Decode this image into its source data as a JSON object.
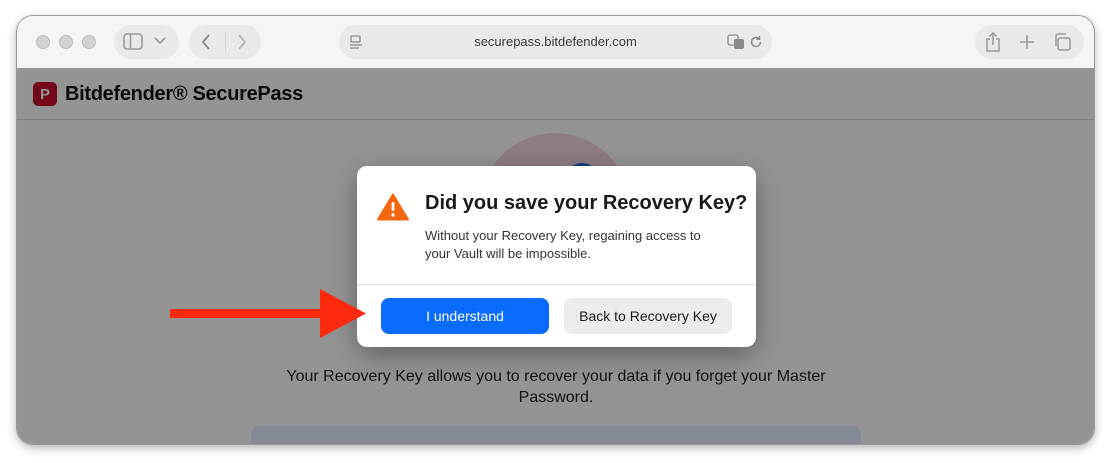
{
  "browser": {
    "url": "securepass.bitdefender.com"
  },
  "app": {
    "brand_name": "Bitdefender® SecurePass",
    "logo_letter": "P",
    "description": "Your Recovery Key allows you to recover your data if you forget your Master Password."
  },
  "dialog": {
    "title": "Did you save your Recovery Key?",
    "message": "Without your Recovery Key, regaining access to your Vault will be impossible.",
    "primary_button": "I understand",
    "secondary_button": "Back to Recovery Key"
  },
  "colors": {
    "primary": "#0a6cff",
    "warning": "#f5670f",
    "annotation_arrow": "#ff2a0d",
    "brand": "#c8102e"
  },
  "icons": [
    "sidebar-icon",
    "chevron-down-icon",
    "back-icon",
    "forward-icon",
    "page-menu-icon",
    "translate-icon",
    "reload-icon",
    "share-icon",
    "new-tab-icon",
    "tabs-icon",
    "warning-icon"
  ]
}
